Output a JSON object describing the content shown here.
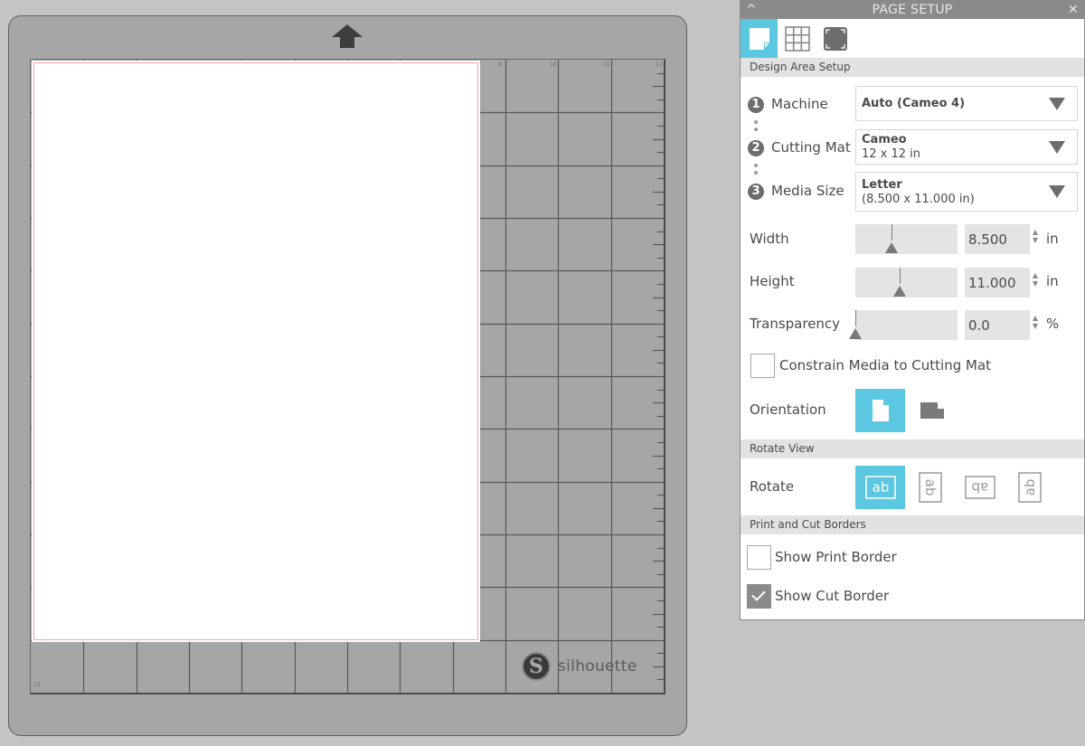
{
  "mat": {
    "feed_direction_icon": "up-arrow-icon",
    "ruler_top": [
      "9",
      "10",
      "11",
      "12"
    ],
    "ruler_corner_bottom": "12",
    "brand_logo_glyph": "S",
    "brand_name": "silhouette",
    "grid_divisions": 12,
    "page_size_in": {
      "width": 8.5,
      "height": 11.0
    },
    "cut_border_color": "#f3a3a6"
  },
  "panel": {
    "title": "PAGE SETUP",
    "collapse_icon": "^",
    "close_icon": "✕",
    "tabs": [
      {
        "name": "design-area-tab",
        "icon": "page-icon",
        "active": true
      },
      {
        "name": "grid-tab",
        "icon": "grid-icon",
        "active": false
      },
      {
        "name": "background-tab",
        "icon": "background-icon",
        "active": false
      }
    ],
    "accent_color": "#5bc7e0",
    "sections": {
      "design_area": "Design Area Setup",
      "rotate_view": "Rotate View",
      "print_cut": "Print and Cut Borders"
    },
    "machine": {
      "step": "1",
      "label": "Machine",
      "value": "Auto (Cameo 4)"
    },
    "cutting_mat": {
      "step": "2",
      "label": "Cutting Mat",
      "value": "Cameo",
      "sub": "12 x 12 in"
    },
    "media_size": {
      "step": "3",
      "label": "Media Size",
      "value": "Letter",
      "sub": "(8.500 x 11.000 in)"
    },
    "width": {
      "label": "Width",
      "value": "8.500",
      "unit": "in",
      "slider_fraction": 0.35
    },
    "height": {
      "label": "Height",
      "value": "11.000",
      "unit": "in",
      "slider_fraction": 0.43
    },
    "transparency": {
      "label": "Transparency",
      "value": "0.0",
      "unit": "%",
      "slider_fraction": 0.0
    },
    "spin_up": "▲",
    "spin_down": "▼",
    "constrain": {
      "label": "Constrain Media to Cutting Mat",
      "checked": false
    },
    "orientation": {
      "label": "Orientation",
      "options": [
        "portrait",
        "landscape"
      ],
      "selected": "portrait"
    },
    "rotate": {
      "label": "Rotate",
      "options": [
        "0°",
        "90°",
        "180°",
        "270°"
      ],
      "selected": "0°",
      "glyph": "ab"
    },
    "show_print_border": {
      "label": "Show Print Border",
      "checked": false
    },
    "show_cut_border": {
      "label": "Show Cut Border",
      "checked": true
    }
  }
}
